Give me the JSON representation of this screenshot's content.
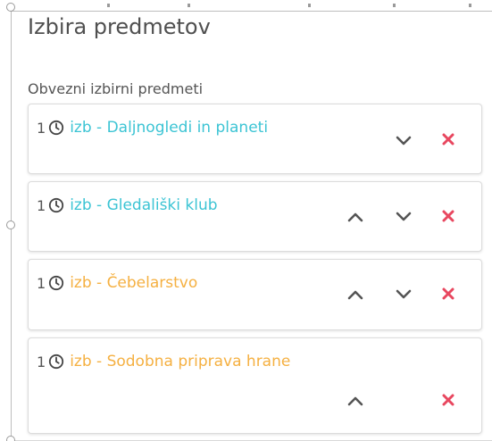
{
  "panel": {
    "title": "Izbira predmetov",
    "section_title": "Obvezni izbirni predmeti"
  },
  "colors": {
    "teal": "#3cc4d4",
    "orange": "#f5b041",
    "remove": "#e8475f",
    "chevron": "#555555"
  },
  "items": [
    {
      "number": "1",
      "label": "izb - Daljnogledi in planeti",
      "color": "teal",
      "controls": [
        "move-down",
        "remove"
      ]
    },
    {
      "number": "1",
      "label": "izb - Gledališki klub",
      "color": "teal",
      "controls": [
        "move-up",
        "move-down",
        "remove"
      ]
    },
    {
      "number": "1",
      "label": "izb - Čebelarstvo",
      "color": "orange",
      "controls": [
        "move-up",
        "move-down",
        "remove"
      ]
    },
    {
      "number": "1",
      "label": "izb - Sodobna priprava hrane",
      "color": "orange",
      "controls": [
        "move-up",
        "remove"
      ]
    }
  ],
  "icons": {
    "item_icon": "clock-icon",
    "up": "chevron-up-icon",
    "down": "chevron-down-icon",
    "remove": "close-icon"
  }
}
